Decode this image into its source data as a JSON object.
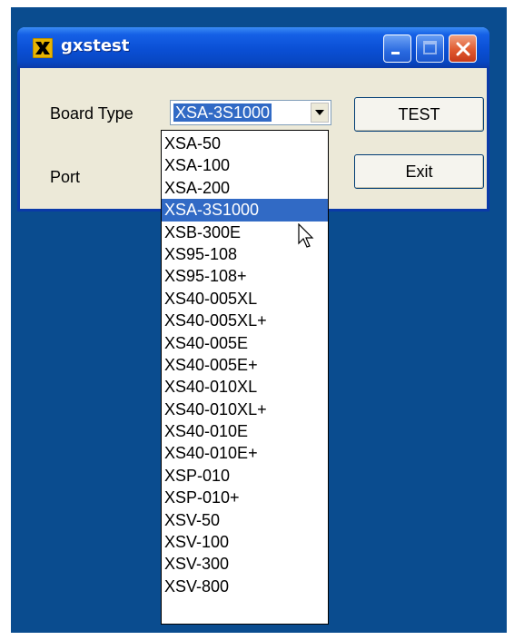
{
  "window": {
    "title": "gxstest",
    "controls": [
      "minimize",
      "maximize",
      "close"
    ]
  },
  "form": {
    "board_type_label": "Board Type",
    "port_label": "Port",
    "board_type_value": "XSA-3S1000",
    "test_button": "TEST",
    "exit_button": "Exit"
  },
  "dropdown": {
    "selected": "XSA-3S1000",
    "options": [
      "XSA-50",
      "XSA-100",
      "XSA-200",
      "XSA-3S1000",
      "XSB-300E",
      "XS95-108",
      "XS95-108+",
      "XS40-005XL",
      "XS40-005XL+",
      "XS40-005E",
      "XS40-005E+",
      "XS40-010XL",
      "XS40-010XL+",
      "XS40-010E",
      "XS40-010E+",
      "XSP-010",
      "XSP-010+",
      "XSV-50",
      "XSV-100",
      "XSV-300",
      "XSV-800"
    ]
  },
  "colors": {
    "desktop": "#0a4c8f",
    "selection": "#316ac5",
    "titlebar": "#0a4fd4"
  }
}
